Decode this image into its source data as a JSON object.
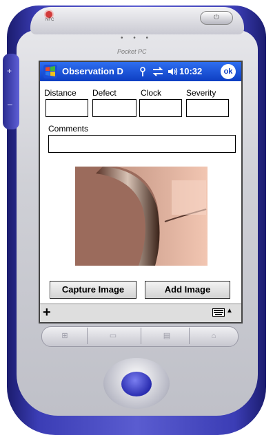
{
  "device": {
    "brand": "Pocket PC",
    "nfc_label": "NFC",
    "power_glyph": "⏻"
  },
  "titlebar": {
    "app_title": "Observation D",
    "time": "10:32",
    "ok_label": "ok"
  },
  "form": {
    "fields": [
      {
        "label": "Distance",
        "value": ""
      },
      {
        "label": "Defect",
        "value": ""
      },
      {
        "label": "Clock",
        "value": ""
      },
      {
        "label": "Severity",
        "value": ""
      }
    ],
    "comments_label": "Comments",
    "comments_value": ""
  },
  "buttons": {
    "capture": "Capture Image",
    "add": "Add Image"
  },
  "bottombar": {
    "new_label": "+",
    "input_arrow": "▲"
  },
  "colors": {
    "titlebar_top": "#2e6ef0",
    "titlebar_bottom": "#0e3ec2",
    "device_blue": "#3b3db5"
  },
  "icons": [
    "start-flag-icon",
    "signal-icon",
    "sync-icon",
    "speaker-icon",
    "keyboard-icon",
    "calendar-icon",
    "contacts-icon",
    "inbox-icon",
    "home-icon"
  ]
}
